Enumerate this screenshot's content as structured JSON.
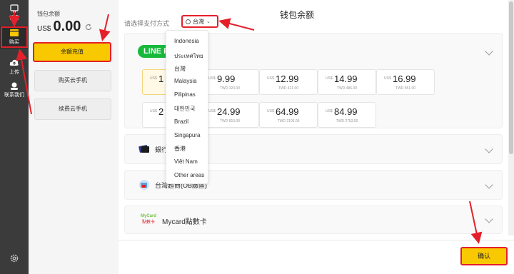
{
  "nav": {
    "items": [
      {
        "label": "设备",
        "icon": "device-icon"
      },
      {
        "label": "购买",
        "icon": "cart-icon",
        "active": true
      },
      {
        "label": "上传",
        "icon": "upload-cloud-icon"
      },
      {
        "label": "联系我们",
        "icon": "support-icon"
      }
    ],
    "settings_icon": "gear-icon"
  },
  "sidebar": {
    "balance_label": "钱包余额",
    "currency": "US$",
    "balance": "0.00",
    "buttons": [
      "余额充值",
      "购买云手机",
      "续费云手机"
    ]
  },
  "main": {
    "title": "钱包余额",
    "payment_label": "请选择支付方式",
    "region": "台灣",
    "line_pay_logo": "LINE Pa",
    "amounts": [
      {
        "cur": "US$",
        "val": "1",
        "twd": "TWD",
        "selected": true
      },
      {
        "cur": "US$",
        "val": "9.99",
        "twd": "TWD 324.00"
      },
      {
        "cur": "US$",
        "val": "12.99",
        "twd": "TWD 421.00"
      },
      {
        "cur": "US$",
        "val": "14.99",
        "twd": "TWD 486.00"
      },
      {
        "cur": "US$",
        "val": "16.99",
        "twd": "TWD 551.00"
      },
      {
        "cur": "US$",
        "val": "2",
        "twd": "TWD"
      },
      {
        "cur": "US$",
        "val": "24.99",
        "twd": "TWD 810.00"
      },
      {
        "cur": "US$",
        "val": "64.99",
        "twd": "TWD 2105.00"
      },
      {
        "cur": "US$",
        "val": "84.99",
        "twd": "TWD 2753.00"
      }
    ],
    "methods": [
      {
        "name": "銀行",
        "icon": "bank-card-icon"
      },
      {
        "name": "台灣超商(OB繳區)",
        "icon": "store-icon"
      },
      {
        "name": "Mycard點數卡",
        "icon": "mycard-logo"
      }
    ],
    "mycard_logo_text": [
      "MyCard",
      "點數卡"
    ],
    "confirm_label": "确认"
  },
  "dropdown": {
    "options": [
      "Indonesia",
      "ประเทศไทย",
      "台灣",
      "Malaysia",
      "Pilipinas",
      "대한민국",
      "Brazil",
      "Singapura",
      "香港",
      "Việt Nam",
      "Other areas"
    ]
  },
  "colors": {
    "accent": "#f8c900",
    "annotation": "#e4202a",
    "nav_bg": "#3b3b3b",
    "line_green": "#18b93a"
  }
}
